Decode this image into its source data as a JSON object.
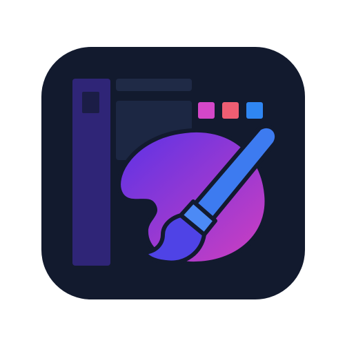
{
  "icon": {
    "name": "paint-app-icon",
    "depicts": [
      "app-window-icon",
      "paint-palette-icon",
      "paintbrush-icon"
    ]
  },
  "colors": {
    "page_background": "#ffffff",
    "tile_background": "#121a2e",
    "sidebar": "#2f2577",
    "sidebar_block": "#1b1d46",
    "window_panel": "#1c2743",
    "title_bar": "#1f2a46",
    "swatch_pink": "#d447c8",
    "swatch_red": "#ef5e73",
    "swatch_blue": "#2f86f2",
    "palette_gradient_start": "#5a32e6",
    "palette_gradient_end": "#d03fc0",
    "brush_handle": "#3d7bf0",
    "brush_ferrule": "#4c8af5",
    "brush_tip": "#4f43e6",
    "outline": "#121a2e"
  }
}
